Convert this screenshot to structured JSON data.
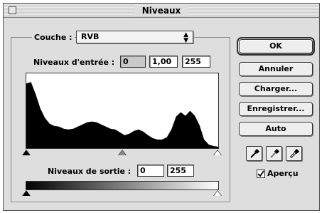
{
  "window": {
    "title": "Niveaux"
  },
  "channel": {
    "label": "Couche :",
    "value": "RVB"
  },
  "input_levels": {
    "label": "Niveaux d'entrée :",
    "black": "0",
    "gamma": "1,00",
    "white": "255"
  },
  "output_levels": {
    "label": "Niveaux de sortie :",
    "black": "0",
    "white": "255"
  },
  "buttons": {
    "ok": "OK",
    "cancel": "Annuler",
    "load": "Charger...",
    "save": "Enregistrer...",
    "auto": "Auto"
  },
  "preview": {
    "label": "Aperçu",
    "checked": true
  },
  "icons": {
    "eyedroppers": [
      "black-eyedropper-icon",
      "gray-eyedropper-icon",
      "white-eyedropper-icon"
    ]
  },
  "histogram": {
    "levels": [
      0.9,
      0.92,
      0.75,
      0.55,
      0.42,
      0.34,
      0.31,
      0.3,
      0.27,
      0.26,
      0.27,
      0.3,
      0.33,
      0.36,
      0.37,
      0.36,
      0.33,
      0.3,
      0.27,
      0.26,
      0.22,
      0.18,
      0.2,
      0.24,
      0.26,
      0.23,
      0.18,
      0.14,
      0.12,
      0.12,
      0.15,
      0.26,
      0.44,
      0.5,
      0.45,
      0.52,
      0.45,
      0.32,
      0.12,
      0.05,
      0.03,
      0.02
    ]
  }
}
